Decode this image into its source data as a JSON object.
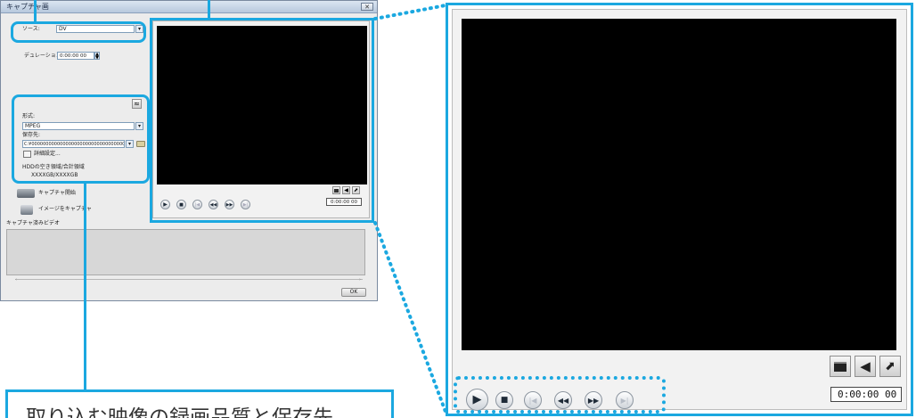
{
  "window": {
    "title": "キャプチャ画",
    "close_glyph": "✕",
    "source_label": "ソース:",
    "source_value": "DV",
    "duration_label": "デュレーション:",
    "duration_value": "0:00:00 00",
    "format_label": "形式:",
    "format_value": "MPEG",
    "save_to_label": "保存先:",
    "save_to_value": "C:¥000000000000000000000000000000000",
    "detail_settings": "詳細設定...",
    "hdd_label": "HDDの空き領域/合計領域",
    "hdd_value": "XXXXGB/XXXXGB",
    "start_capture": "キャプチャ開始",
    "capture_image": "イメージをキャプチャ",
    "captured_videos": "キャプチャ済みビデオ",
    "ok": "OK",
    "small_timecode": "0:00:00 00"
  },
  "zoom": {
    "timecode": "0:00:00 00"
  },
  "callout": {
    "text": "取り込む映像の録画品質と保存先"
  },
  "colors": {
    "accent": "#1ba8e0",
    "screen": "#000000",
    "window_bg": "#ececec"
  },
  "icons": [
    "play-icon",
    "stop-icon",
    "skip-back-icon",
    "rewind-icon",
    "fast-forward-icon",
    "skip-forward-icon",
    "fullscreen-icon",
    "volume-icon",
    "expand-icon",
    "camera-icon",
    "camcorder-icon",
    "folder-icon"
  ]
}
